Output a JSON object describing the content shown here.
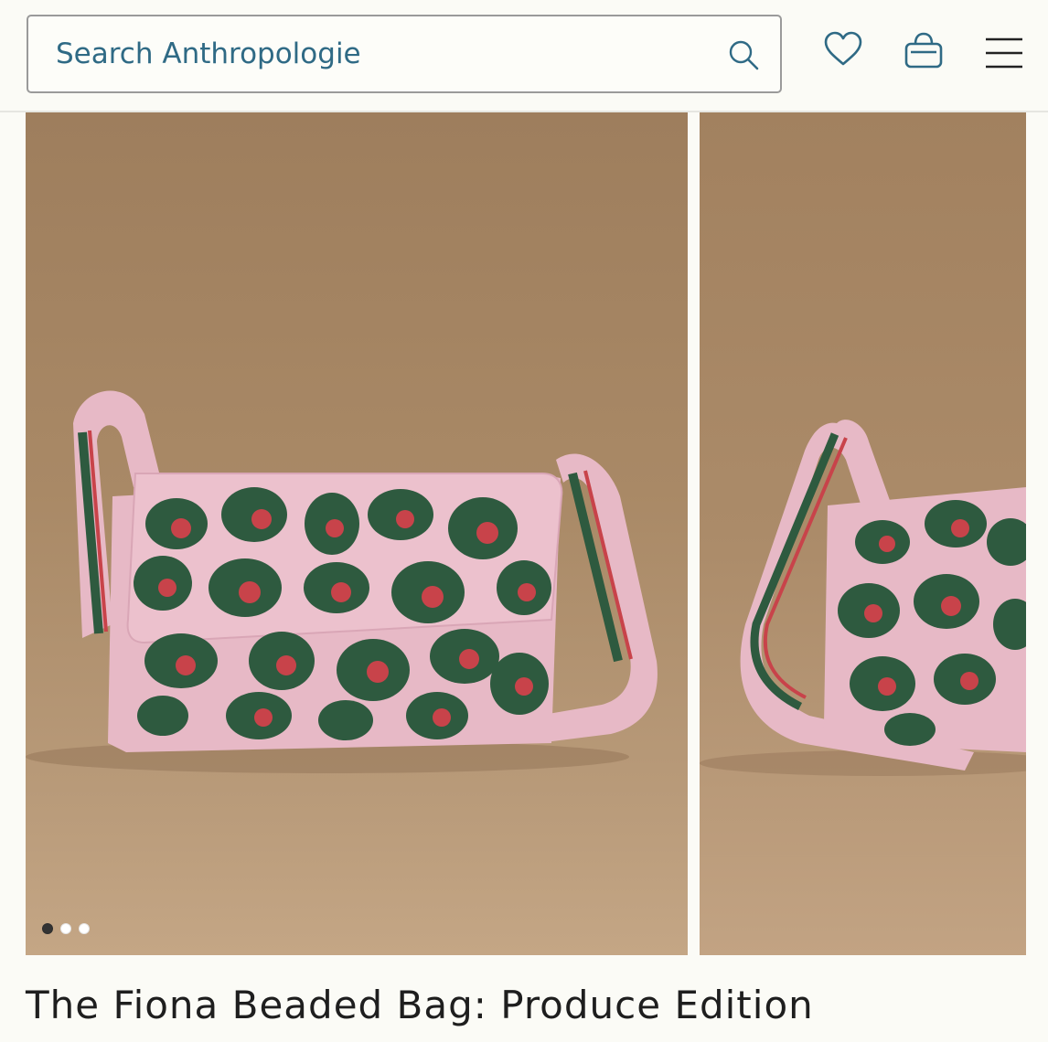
{
  "search": {
    "placeholder": "Search Anthropologie",
    "icon": "search-icon"
  },
  "header_icons": [
    "heart-icon",
    "shopping-bag-icon",
    "hamburger-menu-icon"
  ],
  "colors": {
    "accent": "#2f6a85",
    "bead_pink": "#e8b8c8",
    "bead_green": "#2e5a3f",
    "bead_red": "#c8434a",
    "background": "#fbfbf6"
  },
  "gallery": {
    "images": [
      {
        "alt": "Beaded bag front view"
      },
      {
        "alt": "Beaded bag side view"
      }
    ],
    "dot_count": 3,
    "active_dot": 1
  },
  "product": {
    "title": "The Fiona Beaded Bag: Produce Edition"
  }
}
